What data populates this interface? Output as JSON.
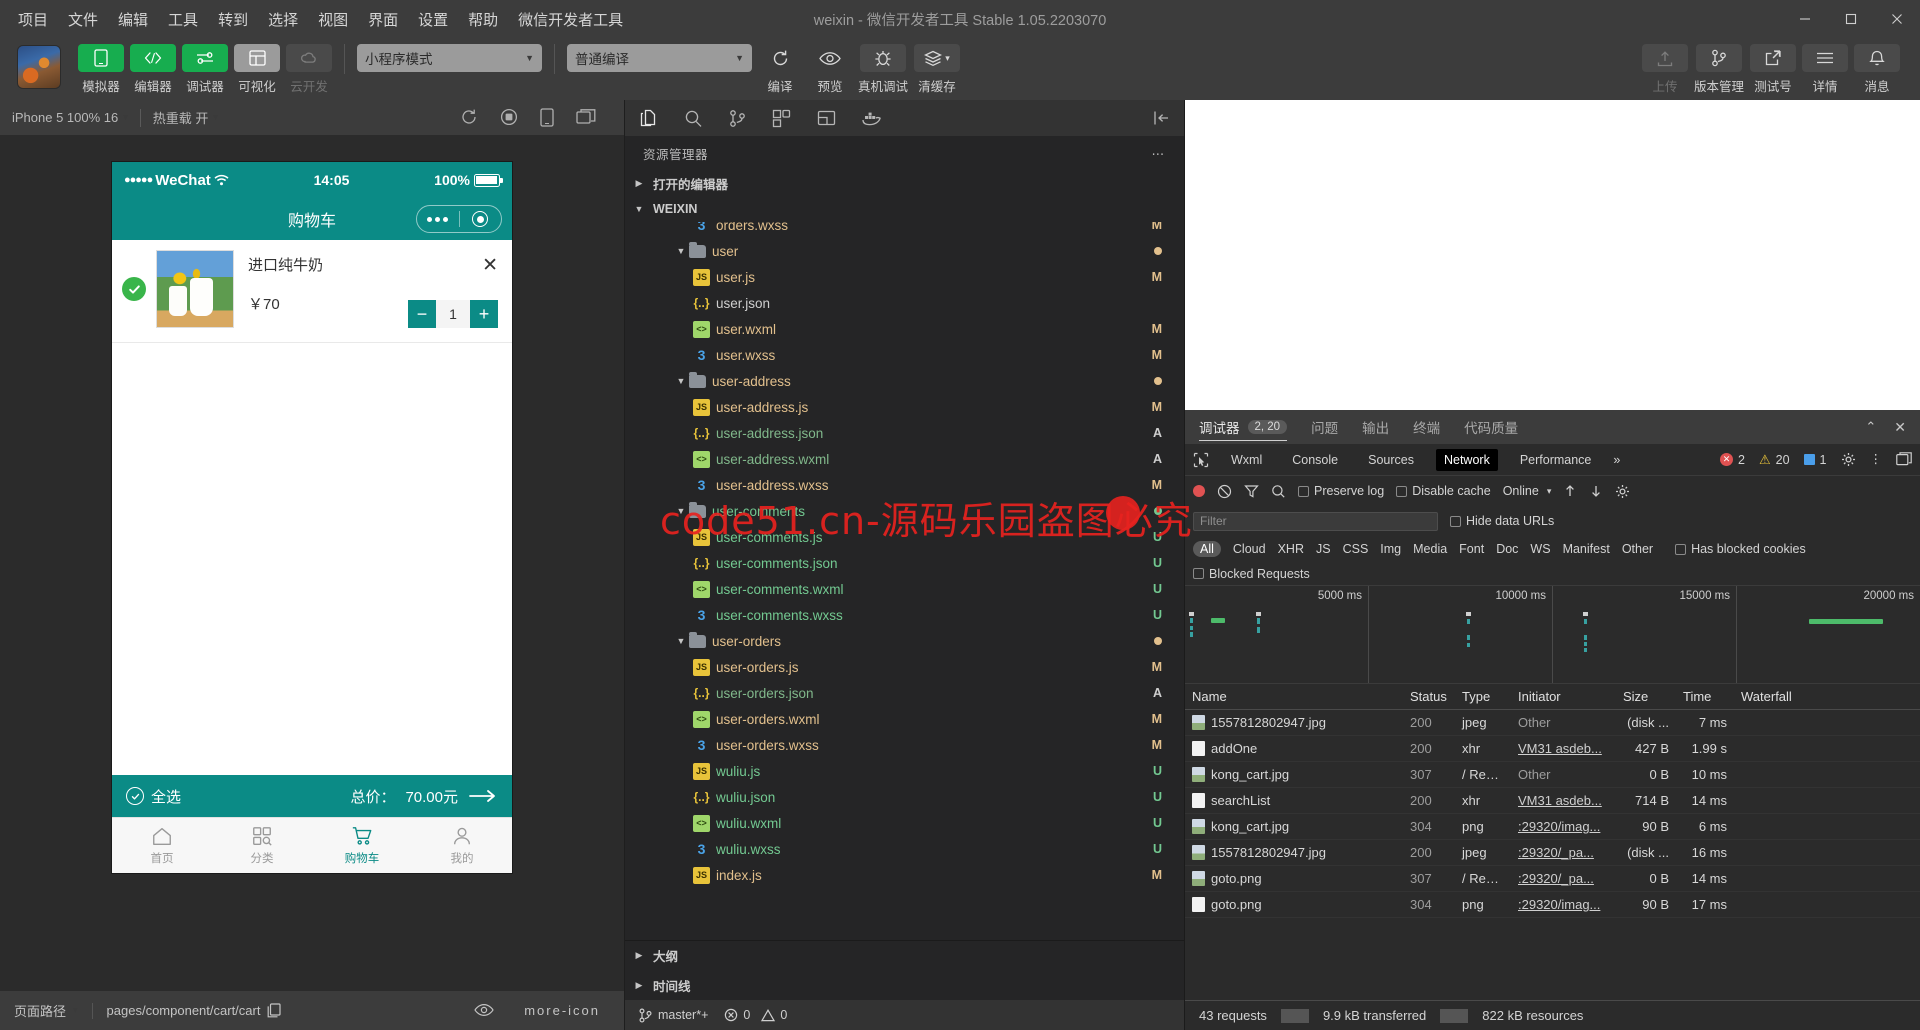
{
  "window": {
    "title": "weixin - 微信开发者工具 Stable 1.05.2203070",
    "menu": [
      "项目",
      "文件",
      "编辑",
      "工具",
      "转到",
      "选择",
      "视图",
      "界面",
      "设置",
      "帮助",
      "微信开发者工具"
    ],
    "controls": {
      "minimize": "—",
      "maximize": "□",
      "close": "✕"
    }
  },
  "toolbar": {
    "buttons": [
      {
        "label": "模拟器",
        "icon": "phone-icon",
        "state": "green"
      },
      {
        "label": "编辑器",
        "icon": "code-icon",
        "state": "green"
      },
      {
        "label": "调试器",
        "icon": "sliders-icon",
        "state": "green"
      },
      {
        "label": "可视化",
        "icon": "layout-icon",
        "state": "grey"
      },
      {
        "label": "云开发",
        "icon": "cloud-icon",
        "state": "disabled"
      }
    ],
    "mode_select": "小程序模式",
    "compile_select": "普通编译",
    "actions": [
      {
        "label": "编译",
        "icon": "refresh-icon"
      },
      {
        "label": "预览",
        "icon": "eye-icon"
      },
      {
        "label": "真机调试",
        "icon": "bug-icon"
      },
      {
        "label": "清缓存",
        "icon": "layers-icon"
      }
    ],
    "right_buttons": [
      {
        "label": "上传",
        "icon": "upload-icon",
        "state": "disabled"
      },
      {
        "label": "版本管理",
        "icon": "branch-icon",
        "state": "normal"
      },
      {
        "label": "测试号",
        "icon": "external-link-icon",
        "state": "normal"
      },
      {
        "label": "详情",
        "icon": "menu-icon",
        "state": "normal"
      },
      {
        "label": "消息",
        "icon": "bell-icon",
        "state": "normal"
      }
    ]
  },
  "simulator": {
    "device_select": "iPhone 5 100% 16",
    "hot_reload": "热重载 开",
    "icons": [
      "refresh-icon",
      "record-icon",
      "device-icon",
      "window-icon"
    ],
    "phone": {
      "status": {
        "carrier": "WeChat",
        "dots": "●●●●●",
        "time": "14:05",
        "battery_percent": "100%"
      },
      "nav_title": "购物车",
      "items": [
        {
          "name": "进口纯牛奶",
          "price": "￥70",
          "qty": "1",
          "checked": true,
          "close": "✕",
          "minus": "−",
          "plus": "+"
        }
      ],
      "total_bar": {
        "select_all": "全选",
        "total_label": "总价：",
        "total_value": "70.00元",
        "arrow": "→"
      },
      "tabs": [
        {
          "label": "首页",
          "icon": "home-icon",
          "active": false
        },
        {
          "label": "分类",
          "icon": "grid-search-icon",
          "active": false
        },
        {
          "label": "购物车",
          "icon": "cart-icon",
          "active": true
        },
        {
          "label": "我的",
          "icon": "user-icon",
          "active": false
        }
      ]
    }
  },
  "explorer": {
    "activity_icons": [
      "files-icon",
      "search-icon",
      "source-control-icon",
      "extensions-icon",
      "debug-icon",
      "docker-icon",
      "collapse-icon"
    ],
    "title": "资源管理器",
    "more": "⋯",
    "sections": [
      {
        "label": "打开的编辑器",
        "expanded": false
      },
      {
        "label": "WEIXIN",
        "expanded": true
      }
    ],
    "tree": [
      {
        "name": "orders.wxss",
        "icon": "wxss",
        "depth": 3,
        "badge": "M",
        "status": "m",
        "clipped": true
      },
      {
        "name": "user",
        "icon": "folder",
        "depth": 2,
        "badge": "dot-m",
        "status": "m"
      },
      {
        "name": "user.js",
        "icon": "js",
        "depth": 3,
        "badge": "M",
        "status": "m"
      },
      {
        "name": "user.json",
        "icon": "json",
        "depth": 3,
        "badge": "",
        "status": "none"
      },
      {
        "name": "user.wxml",
        "icon": "wxml",
        "depth": 3,
        "badge": "M",
        "status": "m"
      },
      {
        "name": "user.wxss",
        "icon": "wxss",
        "depth": 3,
        "badge": "M",
        "status": "m"
      },
      {
        "name": "user-address",
        "icon": "folder",
        "depth": 2,
        "badge": "dot-m",
        "status": "m"
      },
      {
        "name": "user-address.js",
        "icon": "js",
        "depth": 3,
        "badge": "M",
        "status": "m"
      },
      {
        "name": "user-address.json",
        "icon": "json",
        "depth": 3,
        "badge": "A",
        "status": "a"
      },
      {
        "name": "user-address.wxml",
        "icon": "wxml",
        "depth": 3,
        "badge": "A",
        "status": "a"
      },
      {
        "name": "user-address.wxss",
        "icon": "wxss",
        "depth": 3,
        "badge": "M",
        "status": "m"
      },
      {
        "name": "user-comments",
        "icon": "folder",
        "depth": 2,
        "badge": "dot-u",
        "status": "u"
      },
      {
        "name": "user-comments.js",
        "icon": "js",
        "depth": 3,
        "badge": "U",
        "status": "u"
      },
      {
        "name": "user-comments.json",
        "icon": "json",
        "depth": 3,
        "badge": "U",
        "status": "u"
      },
      {
        "name": "user-comments.wxml",
        "icon": "wxml",
        "depth": 3,
        "badge": "U",
        "status": "u"
      },
      {
        "name": "user-comments.wxss",
        "icon": "wxss",
        "depth": 3,
        "badge": "U",
        "status": "u"
      },
      {
        "name": "user-orders",
        "icon": "folder",
        "depth": 2,
        "badge": "dot-m",
        "status": "m"
      },
      {
        "name": "user-orders.js",
        "icon": "js",
        "depth": 3,
        "badge": "M",
        "status": "m"
      },
      {
        "name": "user-orders.json",
        "icon": "json",
        "depth": 3,
        "badge": "A",
        "status": "a"
      },
      {
        "name": "user-orders.wxml",
        "icon": "wxml",
        "depth": 3,
        "badge": "M",
        "status": "m"
      },
      {
        "name": "user-orders.wxss",
        "icon": "wxss",
        "depth": 3,
        "badge": "M",
        "status": "m"
      },
      {
        "name": "wuliu.js",
        "icon": "js",
        "depth": 3,
        "badge": "U",
        "status": "u"
      },
      {
        "name": "wuliu.json",
        "icon": "json",
        "depth": 3,
        "badge": "U",
        "status": "u"
      },
      {
        "name": "wuliu.wxml",
        "icon": "wxml",
        "depth": 3,
        "badge": "U",
        "status": "u"
      },
      {
        "name": "wuliu.wxss",
        "icon": "wxss",
        "depth": 3,
        "badge": "U",
        "status": "u"
      },
      {
        "name": "index.js",
        "icon": "js",
        "depth": 3,
        "badge": "M",
        "status": "m",
        "clippedBottom": true
      }
    ],
    "folds": [
      {
        "label": "大纲"
      },
      {
        "label": "时间线"
      }
    ],
    "status": {
      "branch": "master*+",
      "errors": "0",
      "warnings": "0"
    }
  },
  "devtools": {
    "panel_tabs": [
      {
        "label": "调试器",
        "badge": "2, 20",
        "active": true
      },
      {
        "label": "问题",
        "badge": "",
        "active": false
      },
      {
        "label": "输出",
        "badge": "",
        "active": false
      },
      {
        "label": "终端",
        "badge": "",
        "active": false
      },
      {
        "label": "代码质量",
        "badge": "",
        "active": false
      }
    ],
    "panel_right": [
      "chevron-up-icon",
      "close-icon"
    ],
    "inspector_tabs": [
      "Wxml",
      "Console",
      "Sources",
      "Network",
      "Performance"
    ],
    "active_inspector_tab": "Network",
    "overflow": "»",
    "counters": {
      "errors": "2",
      "warnings": "20",
      "info": "1"
    },
    "network": {
      "toolbar": {
        "record": "record-icon",
        "clear": "clear-icon",
        "filter": "filter-icon",
        "search": "search-icon",
        "preserve_log": "Preserve log",
        "disable_cache": "Disable cache",
        "throttle": "Online",
        "import": "import-icon",
        "export": "export-icon",
        "settings": "settings-icon"
      },
      "filter_placeholder": "Filter",
      "hide_data_urls": "Hide data URLs",
      "types": [
        "All",
        "Cloud",
        "XHR",
        "JS",
        "CSS",
        "Img",
        "Media",
        "Font",
        "Doc",
        "WS",
        "Manifest",
        "Other"
      ],
      "active_type": "All",
      "has_blocked_cookies": "Has blocked cookies",
      "blocked_requests": "Blocked Requests",
      "timeline_ticks": [
        "5000 ms",
        "10000 ms",
        "15000 ms",
        "20000 ms"
      ],
      "columns": [
        "Name",
        "Status",
        "Type",
        "Initiator",
        "Size",
        "Time",
        "Waterfall"
      ],
      "rows": [
        {
          "name": "1557812802947.jpg",
          "icon": "image-file-icon",
          "status": "200",
          "type": "jpeg",
          "initiator": "Other",
          "initiator_link": false,
          "size": "(disk ...",
          "time": "7 ms"
        },
        {
          "name": "addOne",
          "icon": "doc-file-icon",
          "status": "200",
          "type": "xhr",
          "initiator": "VM31 asdeb...",
          "initiator_link": true,
          "size": "427 B",
          "time": "1.99 s"
        },
        {
          "name": "kong_cart.jpg",
          "icon": "image-file-icon",
          "status": "307",
          "type": "/ Redi...",
          "initiator": "Other",
          "initiator_link": false,
          "size": "0 B",
          "time": "10 ms"
        },
        {
          "name": "searchList",
          "icon": "doc-file-icon",
          "status": "200",
          "type": "xhr",
          "initiator": "VM31 asdeb...",
          "initiator_link": true,
          "size": "714 B",
          "time": "14 ms"
        },
        {
          "name": "kong_cart.jpg",
          "icon": "image-file-icon",
          "status": "304",
          "type": "png",
          "initiator": ":29320/imag...",
          "initiator_link": true,
          "size": "90 B",
          "time": "6 ms"
        },
        {
          "name": "1557812802947.jpg",
          "icon": "image-file-icon",
          "status": "200",
          "type": "jpeg",
          "initiator": ":29320/_pa...",
          "initiator_link": true,
          "size": "(disk ...",
          "time": "16 ms"
        },
        {
          "name": "goto.png",
          "icon": "image-file-icon",
          "status": "307",
          "type": "/ Redi...",
          "initiator": ":29320/_pa...",
          "initiator_link": true,
          "size": "0 B",
          "time": "14 ms"
        },
        {
          "name": "goto.png",
          "icon": "doc-file-icon",
          "status": "304",
          "type": "png",
          "initiator": ":29320/imag...",
          "initiator_link": true,
          "size": "90 B",
          "time": "17 ms"
        }
      ],
      "footer": {
        "requests": "43 requests",
        "transferred": "9.9 kB transferred",
        "resources": "822 kB resources"
      }
    }
  },
  "bottom": {
    "page_path_label": "页面路径",
    "page_path_value": "pages/component/cart/cart",
    "copy_icon": "copy-icon",
    "eye_icon": "eye-icon",
    "more_icon": "more-icon"
  },
  "watermark": {
    "text": "code51.cn-源码乐园盗图必究",
    "color": "#e8221f"
  },
  "colors": {
    "accent_green": "#17ad4f",
    "teal": "#0b8b86",
    "modified": "#e2c08d",
    "untracked": "#73c991"
  }
}
